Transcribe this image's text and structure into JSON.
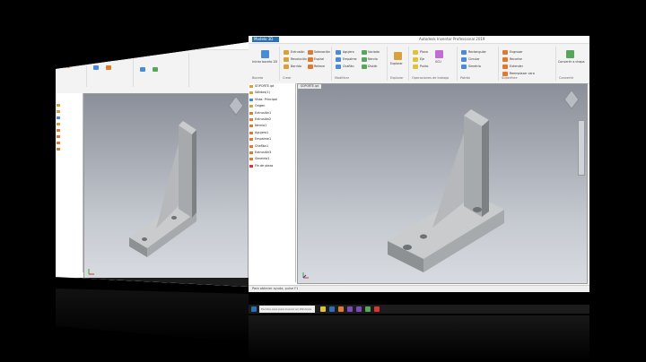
{
  "window": {
    "tab_label": "Modelo 3D",
    "title": "Autodesk Inventor Professional 2019",
    "document_tab": "SOPORTE.ipt",
    "status_text": "Para obtener ayuda, pulse F1",
    "search_placeholder": "Escriba aquí para buscar en Windows"
  },
  "ribbon": {
    "groups": [
      {
        "label": "Boceto",
        "items": [
          "Iniciar boceto 2D"
        ]
      },
      {
        "label": "Crear",
        "items": [
          "Extrusión",
          "Revolución",
          "Barrido",
          "Solevación",
          "Espiral",
          "Relieve"
        ]
      },
      {
        "label": "Modificar",
        "items": [
          "Agujero",
          "Empalme",
          "Chaflán",
          "Vaciado",
          "Nervio",
          "Dividir"
        ]
      },
      {
        "label": "Explorar",
        "items": [
          "Explorar"
        ]
      },
      {
        "label": "Operaciones de trabajo",
        "items": [
          "Plano",
          "Eje",
          "Punto",
          "SCU"
        ]
      },
      {
        "label": "Patrón",
        "items": [
          "Rectangular",
          "Circular",
          "Simetría"
        ]
      },
      {
        "label": "Superficie",
        "items": [
          "Engrosar",
          "Recortar",
          "Extender",
          "Reemplazar cara"
        ]
      },
      {
        "label": "Convertir",
        "items": [
          "Convertir a chapa"
        ]
      }
    ]
  },
  "browser": {
    "items": [
      {
        "label": "SOPORTE.ipt",
        "icon": "part-icon"
      },
      {
        "label": "Sólidos(1)",
        "icon": "folder-icon"
      },
      {
        "label": "Vista: Principal",
        "icon": "view-icon"
      },
      {
        "label": "Origen",
        "icon": "folder-icon"
      },
      {
        "label": "Extrusión1",
        "icon": "extrude-icon"
      },
      {
        "label": "Extrusión2",
        "icon": "extrude-icon"
      },
      {
        "label": "Nervio1",
        "icon": "rib-icon"
      },
      {
        "label": "Agujero1",
        "icon": "hole-icon"
      },
      {
        "label": "Empalme1",
        "icon": "fillet-icon"
      },
      {
        "label": "Chaflán1",
        "icon": "chamfer-icon"
      },
      {
        "label": "Extrusión3",
        "icon": "extrude-icon"
      },
      {
        "label": "Simetría1",
        "icon": "mirror-icon"
      },
      {
        "label": "Fin de pieza",
        "icon": "end-icon"
      }
    ]
  },
  "colors": {
    "accent": "#2c6fb7",
    "viewport_top": "#8a8f99",
    "viewport_bottom": "#d8dbe0",
    "part_face": "#a7aaad",
    "part_top": "#c9cbcd",
    "part_dark": "#7e8184"
  }
}
